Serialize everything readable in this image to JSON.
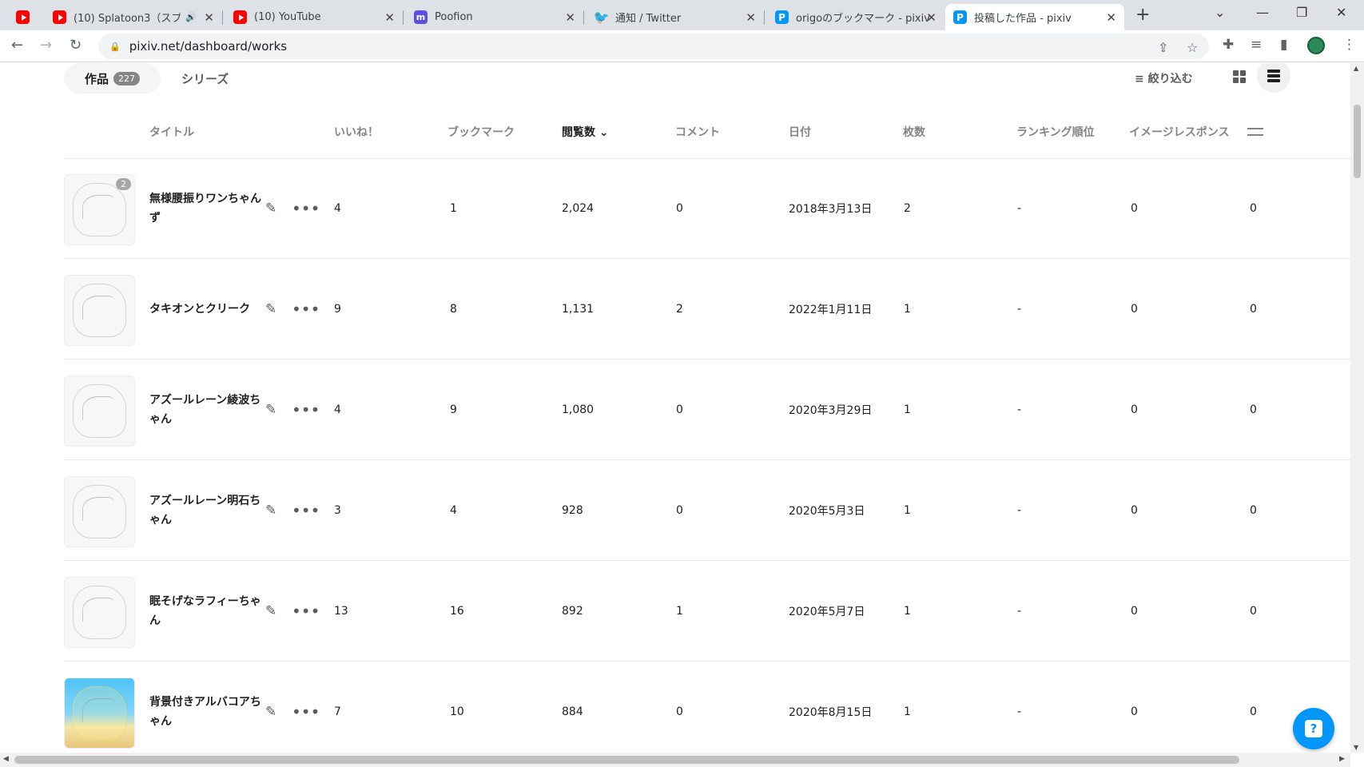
{
  "browser": {
    "tabs": [
      {
        "title": "",
        "favicon": "youtube-icon"
      },
      {
        "title": "(10) Splatoon3（スプラ",
        "favicon": "youtube-icon",
        "audio": true
      },
      {
        "title": "(10) YouTube",
        "favicon": "youtube-icon"
      },
      {
        "title": "Poofion",
        "favicon": "mastodon-icon"
      },
      {
        "title": "通知 / Twitter",
        "favicon": "twitter-icon"
      },
      {
        "title": "origoのブックマーク - pixiv",
        "favicon": "pixiv-icon"
      },
      {
        "title": "投稿した作品 - pixiv",
        "favicon": "pixiv-icon",
        "active": true
      }
    ],
    "url": "pixiv.net/dashboard/works"
  },
  "page": {
    "works_tab": "作品",
    "works_count": "227",
    "series_tab": "シリーズ",
    "filter_label": "絞り込む",
    "columns": {
      "title": "タイトル",
      "likes": "いいね！",
      "bookmarks": "ブックマーク",
      "views": "閲覧数",
      "comments": "コメント",
      "date": "日付",
      "pages": "枚数",
      "ranking": "ランキング順位",
      "image_response": "イメージレスポンス"
    },
    "rows": [
      {
        "title": "無様腰振りワンちゃんず",
        "likes": "4",
        "bookmarks": "1",
        "views": "2,024",
        "comments": "0",
        "date": "2018年3月13日",
        "pages": "2",
        "ranking": "-",
        "image_response": "0",
        "last": "0",
        "page_badge": "2"
      },
      {
        "title": "タキオンとクリーク",
        "likes": "9",
        "bookmarks": "8",
        "views": "1,131",
        "comments": "2",
        "date": "2022年1月11日",
        "pages": "1",
        "ranking": "-",
        "image_response": "0",
        "last": "0"
      },
      {
        "title": "アズールレーン綾波ちゃん",
        "likes": "4",
        "bookmarks": "9",
        "views": "1,080",
        "comments": "0",
        "date": "2020年3月29日",
        "pages": "1",
        "ranking": "-",
        "image_response": "0",
        "last": "0"
      },
      {
        "title": "アズールレーン明石ちゃん",
        "likes": "3",
        "bookmarks": "4",
        "views": "928",
        "comments": "0",
        "date": "2020年5月3日",
        "pages": "1",
        "ranking": "-",
        "image_response": "0",
        "last": "0"
      },
      {
        "title": "眠そげなラフィーちゃん",
        "likes": "13",
        "bookmarks": "16",
        "views": "892",
        "comments": "1",
        "date": "2020年5月7日",
        "pages": "1",
        "ranking": "-",
        "image_response": "0",
        "last": "0"
      },
      {
        "title": "背景付きアルバコアちゃん",
        "likes": "7",
        "bookmarks": "10",
        "views": "884",
        "comments": "0",
        "date": "2020年8月15日",
        "pages": "1",
        "ranking": "-",
        "image_response": "0",
        "last": "0",
        "color_thumb": true
      }
    ]
  },
  "colors": {
    "accent": "#0096fa",
    "text": "#1f1f1f",
    "muted": "#858585"
  }
}
